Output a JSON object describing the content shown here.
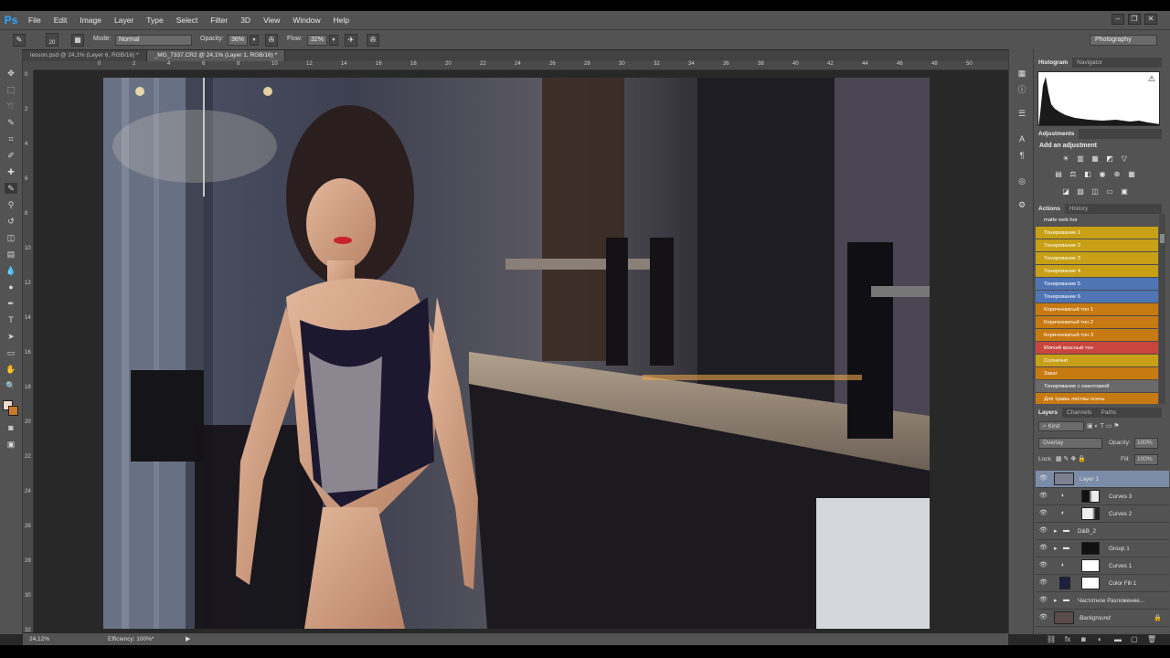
{
  "app": {
    "logo": "Ps"
  },
  "menu": [
    "File",
    "Edit",
    "Image",
    "Layer",
    "Type",
    "Select",
    "Filter",
    "3D",
    "View",
    "Window",
    "Help"
  ],
  "window_controls": [
    "–",
    "❐",
    "✕"
  ],
  "options": {
    "brush_size": "20",
    "mode_label": "Mode:",
    "mode_value": "Normal",
    "opacity_label": "Opacity:",
    "opacity_value": "36%",
    "flow_label": "Flow:",
    "flow_value": "32%",
    "workspace": "Photography"
  },
  "tabs": [
    {
      "label": "lesson.psd @ 24,1% (Layer 6, RGB/16) *"
    },
    {
      "label": "_MG_7337.CR2 @ 24,1% (Layer 1, RGB/16) *"
    }
  ],
  "ruler": {
    "top": [
      "0",
      "2",
      "4",
      "6",
      "8",
      "10",
      "12",
      "14",
      "16",
      "18",
      "20",
      "22",
      "24",
      "26",
      "28",
      "30",
      "32",
      "34",
      "36",
      "38",
      "40",
      "42",
      "44",
      "46",
      "48",
      "50"
    ],
    "left": [
      "0",
      "2",
      "4",
      "6",
      "8",
      "10",
      "12",
      "14",
      "16",
      "18",
      "20",
      "22",
      "24",
      "26",
      "28",
      "30",
      "32"
    ]
  },
  "status": {
    "zoom": "24,12%",
    "efficiency": "Efficiency: 100%*"
  },
  "panels": {
    "histogram_tab": "Histogram",
    "navigator_tab": "Navigator",
    "warning": "⚠",
    "adjustments_tab": "Adjustments",
    "add_adjustment": "Add an adjustment",
    "actions_tab": "Actions",
    "history_tab": "History",
    "layers_tab": "Layers",
    "channels_tab": "Channels",
    "paths_tab": "Paths",
    "kind": "Kind",
    "blend_mode": "Overlay",
    "opacity_label": "Opacity:",
    "opacity_value": "100%",
    "lock_label": "Lock:",
    "fill_label": "Fill:",
    "fill_value": "100%"
  },
  "actions": [
    {
      "label": "matte web hor",
      "color": "#535353"
    },
    {
      "label": "Тонирование 1",
      "color": "#c8a017"
    },
    {
      "label": "Тонирование 2",
      "color": "#c8a017"
    },
    {
      "label": "Тонирование 3",
      "color": "#c8a017"
    },
    {
      "label": "Тонирование 4",
      "color": "#c8a017"
    },
    {
      "label": "Тонирование 5",
      "color": "#4f75b5"
    },
    {
      "label": "Тонирование 6",
      "color": "#4f75b5"
    },
    {
      "label": "Коричневатый тон 1",
      "color": "#c77a12"
    },
    {
      "label": "Коричневатый тон 2",
      "color": "#c77a12"
    },
    {
      "label": "Коричневатый тон 3",
      "color": "#c77a12"
    },
    {
      "label": "Мягкий красный тон",
      "color": "#c9453d"
    },
    {
      "label": "Солнечно",
      "color": "#c8a017"
    },
    {
      "label": "Закат",
      "color": "#c77a12"
    },
    {
      "label": "Тонирование с окантовкой",
      "color": "#6a6a6a"
    },
    {
      "label": "Для травы листвы осень",
      "color": "#c77a12"
    }
  ],
  "layers": [
    {
      "name": "Layer 1",
      "selected": true
    },
    {
      "name": "Curves 3"
    },
    {
      "name": "Curves 2"
    },
    {
      "name": "D&B_2"
    },
    {
      "name": "Group 1"
    },
    {
      "name": "Curves 1"
    },
    {
      "name": "Color Fill 1"
    },
    {
      "name": "Частотное Разложение..."
    },
    {
      "name": "Background"
    }
  ]
}
